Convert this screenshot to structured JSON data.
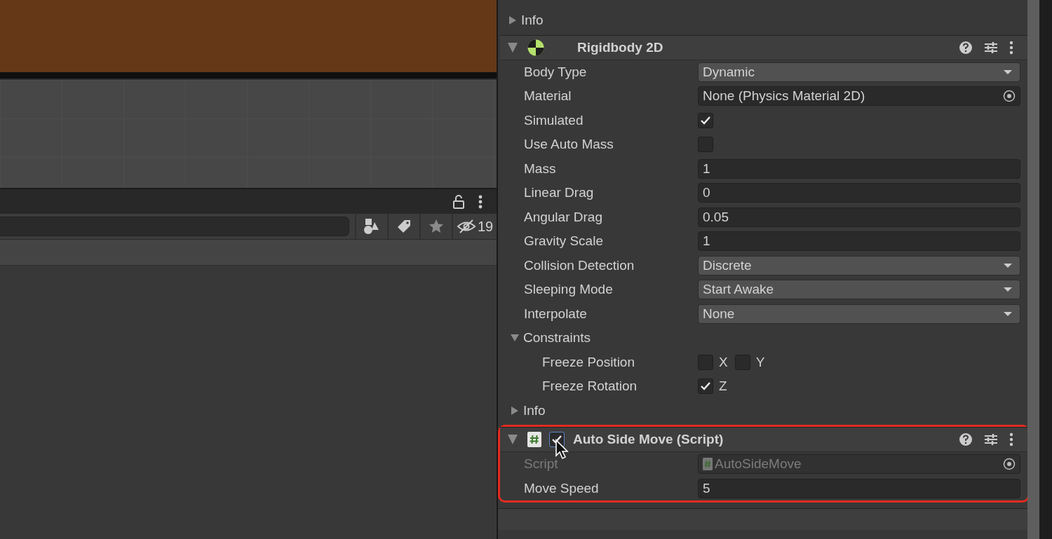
{
  "project_panel": {
    "hidden_count": "19"
  },
  "inspector": {
    "components": [
      {
        "kind": "foldout",
        "label": "Info",
        "expanded": false
      },
      {
        "kind": "physics_component",
        "title": "Rigidbody 2D",
        "expanded": true,
        "properties": [
          {
            "kind": "dropdown",
            "label": "Body Type",
            "value": "Dynamic"
          },
          {
            "kind": "object",
            "label": "Material",
            "value": "None (Physics Material 2D)",
            "disabled": false
          },
          {
            "kind": "checkbox",
            "label": "Simulated",
            "checked": true
          },
          {
            "kind": "checkbox",
            "label": "Use Auto Mass",
            "checked": false
          },
          {
            "kind": "number",
            "label": "Mass",
            "value": "1"
          },
          {
            "kind": "number",
            "label": "Linear Drag",
            "value": "0"
          },
          {
            "kind": "number",
            "label": "Angular Drag",
            "value": "0.05"
          },
          {
            "kind": "number",
            "label": "Gravity Scale",
            "value": "1"
          },
          {
            "kind": "dropdown",
            "label": "Collision Detection",
            "value": "Discrete"
          },
          {
            "kind": "dropdown",
            "label": "Sleeping Mode",
            "value": "Start Awake"
          },
          {
            "kind": "dropdown",
            "label": "Interpolate",
            "value": "None"
          },
          {
            "kind": "foldout",
            "label": "Constraints",
            "expanded": true,
            "children": [
              {
                "kind": "axes",
                "label": "Freeze Position",
                "axes": [
                  {
                    "label": "X",
                    "checked": false
                  },
                  {
                    "label": "Y",
                    "checked": false
                  }
                ]
              },
              {
                "kind": "axes",
                "label": "Freeze Rotation",
                "axes": [
                  {
                    "label": "Z",
                    "checked": true
                  }
                ]
              }
            ]
          },
          {
            "kind": "foldout",
            "label": "Info",
            "expanded": false
          }
        ]
      },
      {
        "kind": "script_component",
        "title": "Auto Side Move (Script)",
        "enabled": true,
        "expanded": true,
        "highlighted": true,
        "properties": [
          {
            "kind": "script_ref",
            "label": "Script",
            "value": "AutoSideMove",
            "disabled": true
          },
          {
            "kind": "number",
            "label": "Move Speed",
            "value": "5"
          }
        ]
      }
    ]
  }
}
